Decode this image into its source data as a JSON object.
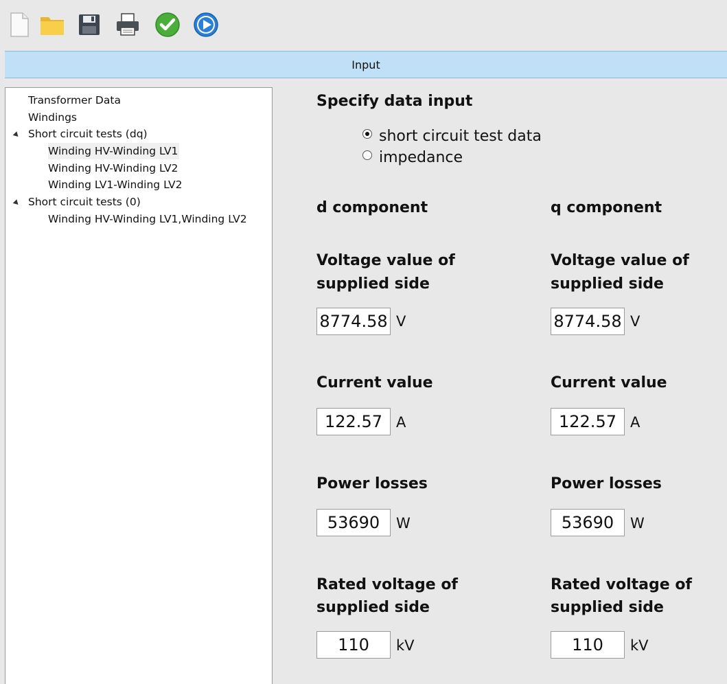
{
  "toolbar": {
    "buttons": [
      {
        "name": "new-document-icon"
      },
      {
        "name": "open-folder-icon"
      },
      {
        "name": "save-icon"
      },
      {
        "name": "print-icon"
      },
      {
        "name": "check-icon"
      },
      {
        "name": "play-icon"
      }
    ]
  },
  "banner": {
    "title": "Input"
  },
  "tree": {
    "items": [
      {
        "label": "Transformer Data"
      },
      {
        "label": "Windings"
      },
      {
        "label": "Short circuit tests (dq)"
      },
      {
        "label": "Winding HV-Winding LV1",
        "selected": true
      },
      {
        "label": "Winding HV-Winding LV2"
      },
      {
        "label": "Winding LV1-Winding LV2"
      },
      {
        "label": "Short circuit tests (0)"
      },
      {
        "label": "Winding HV-Winding LV1,Winding LV2"
      }
    ]
  },
  "form": {
    "title": "Specify data input",
    "radio_options": [
      {
        "label": "short circuit test data",
        "checked": true
      },
      {
        "label": "impedance",
        "checked": false
      }
    ],
    "d": {
      "header": "d component",
      "voltage_label_1": "Voltage value of",
      "voltage_label_2": "supplied side",
      "voltage_value": "8774.58",
      "voltage_unit": "V",
      "current_label": "Current value",
      "current_value": "122.57",
      "current_unit": "A",
      "losses_label": "Power losses",
      "losses_value": "53690",
      "losses_unit": "W",
      "rated_label_1": "Rated voltage of",
      "rated_label_2": "supplied side",
      "rated_value": "110",
      "rated_unit": "kV"
    },
    "q": {
      "header": "q component",
      "voltage_label_1": "Voltage value of",
      "voltage_label_2": "supplied side",
      "voltage_value": "8774.58",
      "voltage_unit": "V",
      "current_label": "Current value",
      "current_value": "122.57",
      "current_unit": "A",
      "losses_label": "Power losses",
      "losses_value": "53690",
      "losses_unit": "W",
      "rated_label_1": "Rated voltage of",
      "rated_label_2": "supplied side",
      "rated_value": "110",
      "rated_unit": "kV"
    }
  }
}
